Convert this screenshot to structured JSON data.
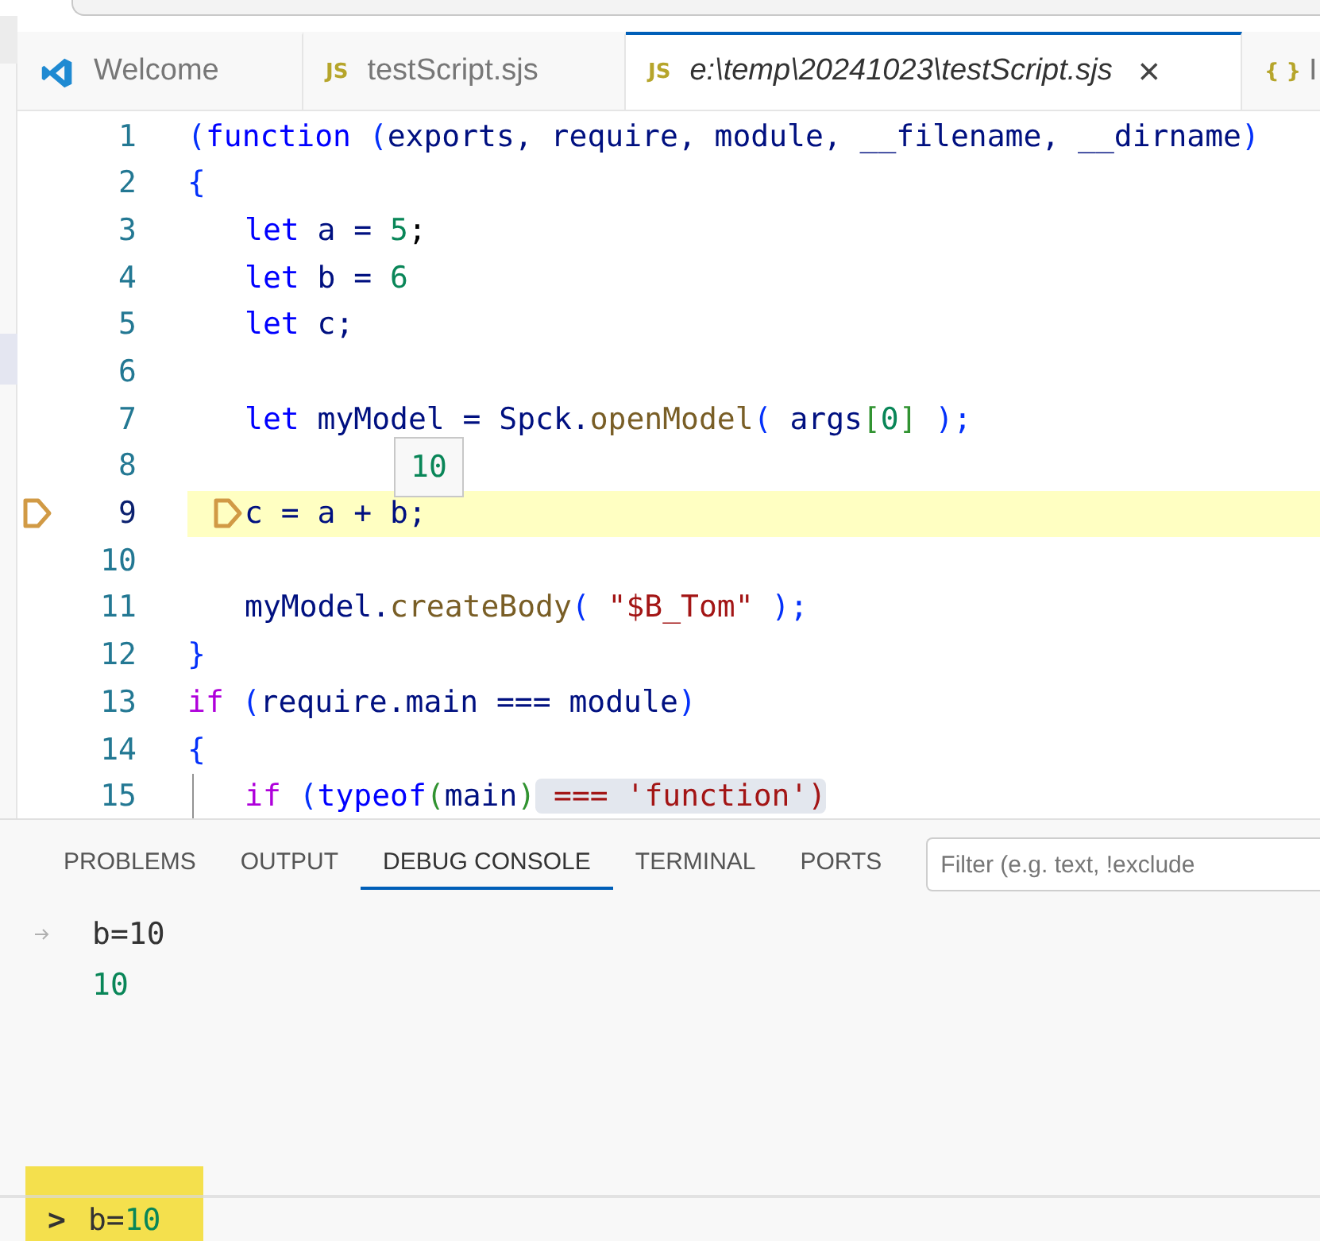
{
  "tabs": [
    {
      "label": "Welcome",
      "kind": "welcome",
      "selected": false,
      "italic": false,
      "closable": false
    },
    {
      "label": "testScript.sjs",
      "kind": "script",
      "badge": "JS",
      "selected": false,
      "italic": false,
      "closable": false
    },
    {
      "label": "e:\\temp\\20241023\\testScript.sjs",
      "kind": "script",
      "badge": "JS",
      "selected": true,
      "italic": true,
      "closable": true
    },
    {
      "label": "I",
      "kind": "json",
      "badge": "{ }",
      "selected": false
    }
  ],
  "close_glyph": "×",
  "editor": {
    "lines": [
      {
        "number": "1",
        "indented": false,
        "current": false,
        "breakpoint": false,
        "tokens": [
          {
            "t": "(",
            "kind": "bracket"
          },
          {
            "t": "function",
            "kind": "keyword"
          },
          {
            "t": " (",
            "kind": "bracket"
          },
          {
            "t": "exports, require, module, __filename, __dirname",
            "kind": "var"
          },
          {
            "t": ")",
            "kind": "bracket"
          }
        ]
      },
      {
        "number": "2",
        "indented": false,
        "current": false,
        "breakpoint": false,
        "tokens": [
          {
            "t": "{",
            "kind": "bracket"
          }
        ]
      },
      {
        "number": "3",
        "indented": true,
        "current": false,
        "breakpoint": false,
        "tokens": [
          {
            "t": "let ",
            "kind": "keyword"
          },
          {
            "t": "a = ",
            "kind": "var"
          },
          {
            "t": "5",
            "kind": "num"
          },
          {
            "t": ";",
            "kind": "plain"
          }
        ]
      },
      {
        "number": "4",
        "indented": true,
        "current": false,
        "breakpoint": false,
        "tokens": [
          {
            "t": "let ",
            "kind": "keyword"
          },
          {
            "t": "b = ",
            "kind": "var"
          },
          {
            "t": "6",
            "kind": "num"
          }
        ]
      },
      {
        "number": "5",
        "indented": true,
        "current": false,
        "breakpoint": false,
        "tokens": [
          {
            "t": "let ",
            "kind": "keyword"
          },
          {
            "t": "c;",
            "kind": "var"
          }
        ]
      },
      {
        "number": "6",
        "current": false,
        "breakpoint": false
      },
      {
        "number": "7",
        "indented": true,
        "current": false,
        "breakpoint": false,
        "tokens": [
          {
            "t": "let ",
            "kind": "keyword"
          },
          {
            "t": "myModel = Spck.",
            "kind": "var"
          },
          {
            "t": "openModel",
            "kind": "func"
          },
          {
            "t": "( ",
            "kind": "bracket"
          },
          {
            "t": "args",
            "kind": "var"
          },
          {
            "t": "[",
            "kind": "bracket2"
          },
          {
            "t": "0",
            "kind": "num"
          },
          {
            "t": "]",
            "kind": "bracket2"
          },
          {
            "t": " );",
            "kind": "bracket"
          }
        ]
      },
      {
        "number": "8",
        "current": false,
        "breakpoint": false
      },
      {
        "number": "9",
        "indented": true,
        "current": true,
        "breakpoint": true,
        "tokens": [
          {
            "t": "c = a + b;",
            "kind": "var"
          }
        ]
      },
      {
        "number": "10",
        "current": false,
        "breakpoint": false
      },
      {
        "number": "11",
        "indented": true,
        "current": false,
        "breakpoint": false,
        "tokens": [
          {
            "t": "myModel.",
            "kind": "var"
          },
          {
            "t": "createBody",
            "kind": "func"
          },
          {
            "t": "( ",
            "kind": "bracket"
          },
          {
            "t": "\"$B_Tom\"",
            "kind": "str"
          },
          {
            "t": " );",
            "kind": "bracket"
          }
        ]
      },
      {
        "number": "12",
        "indented": false,
        "current": false,
        "breakpoint": false,
        "tokens": [
          {
            "t": "}",
            "kind": "bracket"
          }
        ]
      },
      {
        "number": "13",
        "indented": false,
        "current": false,
        "breakpoint": false,
        "tokens": [
          {
            "t": "if ",
            "kind": "control"
          },
          {
            "t": "(",
            "kind": "bracket"
          },
          {
            "t": "require.main === module",
            "kind": "var"
          },
          {
            "t": ")",
            "kind": "bracket"
          }
        ]
      },
      {
        "number": "14",
        "indented": false,
        "current": false,
        "breakpoint": false,
        "tokens": [
          {
            "t": "{",
            "kind": "bracket"
          }
        ]
      },
      {
        "number": "15",
        "indented": true,
        "current": false,
        "breakpoint": false,
        "tokens": [
          {
            "t": "if ",
            "kind": "control"
          },
          {
            "t": "(",
            "kind": "bracket"
          },
          {
            "t": "typeof",
            "kind": "keyword"
          },
          {
            "t": "(",
            "kind": "bracket2"
          },
          {
            "t": "main",
            "kind": "var"
          },
          {
            "t": ")",
            "kind": "bracket2"
          },
          {
            "t": " === 'function')",
            "kind": "highlight"
          }
        ]
      }
    ],
    "hover": {
      "value": "10"
    }
  },
  "panel": {
    "tabs": [
      {
        "label": "PROBLEMS",
        "selected": false
      },
      {
        "label": "OUTPUT",
        "selected": false
      },
      {
        "label": "DEBUG CONSOLE",
        "selected": true
      },
      {
        "label": "TERMINAL",
        "selected": false
      },
      {
        "label": "PORTS",
        "selected": false
      }
    ],
    "filter": {
      "placeholder": "Filter (e.g. text, !exclude"
    },
    "console": [
      {
        "kind": "input",
        "text": "b=10"
      },
      {
        "kind": "result",
        "text": "10"
      }
    ],
    "prompt": {
      "glyph": ">",
      "name": "b=",
      "value": "10",
      "highlighted": true
    }
  }
}
